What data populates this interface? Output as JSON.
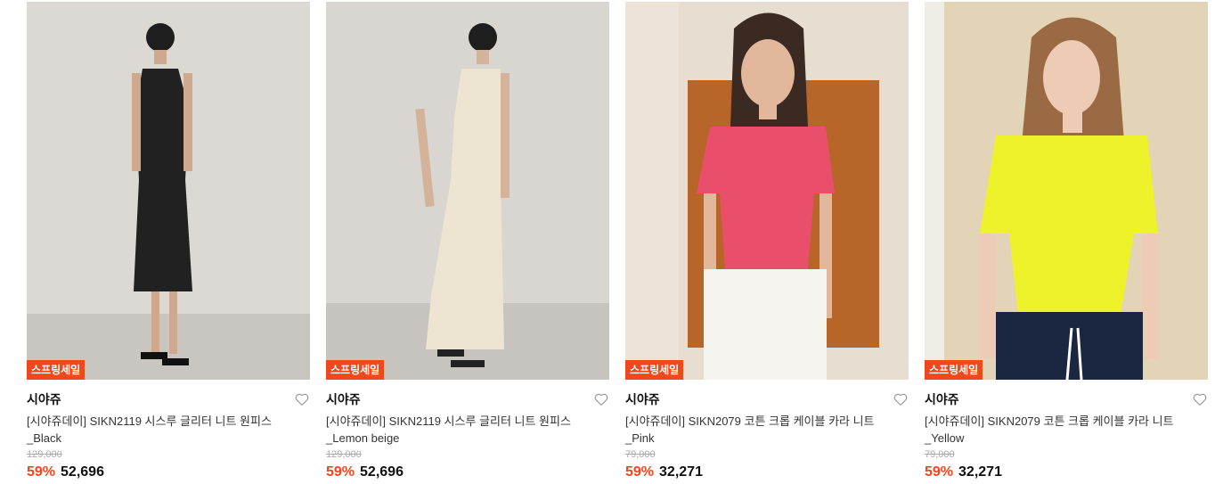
{
  "products": [
    {
      "badge": "스프링세일",
      "brand": "시야쥬",
      "title_line1": "[시야쥬데이] SIKN2119 시스루 글리터 니트 원피스",
      "title_line2": "_Black",
      "original_price": "129,000",
      "discount": "59%",
      "price": "52,696",
      "colors": {
        "bg": "#dcd8d3",
        "floor": "#c9c6c1",
        "garment": "#111111"
      }
    },
    {
      "badge": "스프링세일",
      "brand": "시야쥬",
      "title_line1": "[시야쥬데이] SIKN2119 시스루 글리터 니트 원피스",
      "title_line2": "_Lemon beige",
      "original_price": "129,000",
      "discount": "59%",
      "price": "52,696",
      "colors": {
        "bg": "#d9d6d1",
        "floor": "#c7c4bf",
        "garment": "#eee4d2"
      }
    },
    {
      "badge": "스프링세일",
      "brand": "시야쥬",
      "title_line1": "[시야쥬데이] SIKN2079 코튼 크롭 케이블 카라 니트",
      "title_line2": "_Pink",
      "original_price": "79,000",
      "discount": "59%",
      "price": "32,271",
      "colors": {
        "bg": "#e7ddd0",
        "floor": "#b8652a",
        "garment": "#e94f6a"
      }
    },
    {
      "badge": "스프링세일",
      "brand": "시야쥬",
      "title_line1": "[시야쥬데이] SIKN2079 코튼 크롭 케이블 카라 니트",
      "title_line2": "_Yellow",
      "original_price": "79,000",
      "discount": "59%",
      "price": "32,271",
      "colors": {
        "bg": "#e3d4b8",
        "floor": "#1b2740",
        "garment": "#eef22a"
      }
    }
  ]
}
